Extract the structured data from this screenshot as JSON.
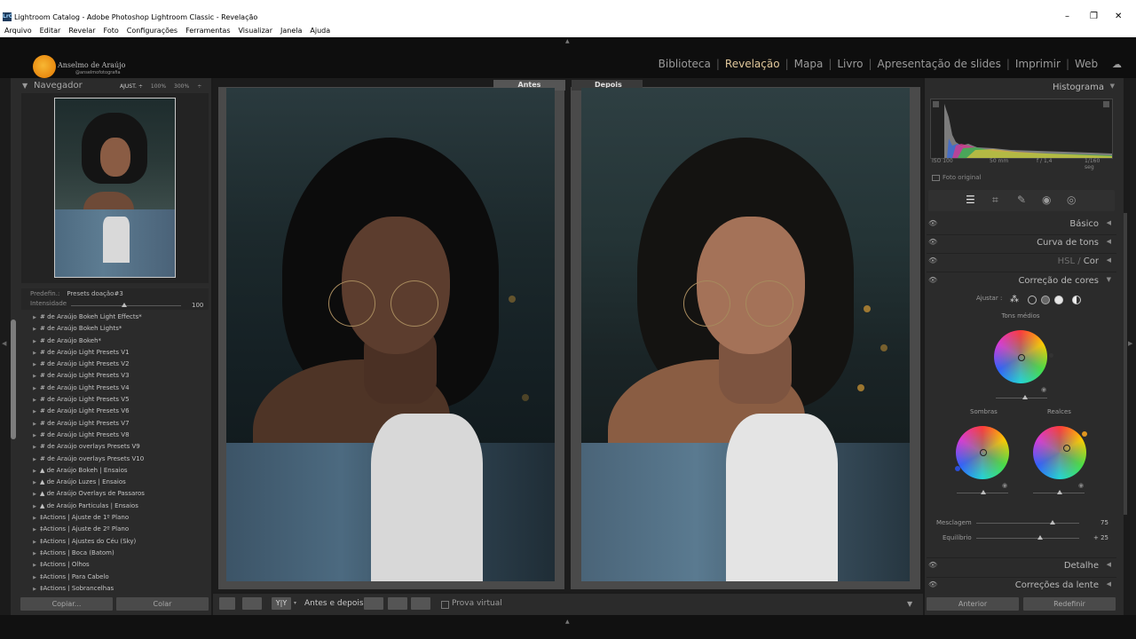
{
  "window": {
    "title": "Lightroom Catalog - Adobe Photoshop Lightroom Classic - Revelação",
    "app_icon_text": "LrC",
    "controls": [
      "–",
      "❐",
      "✕"
    ]
  },
  "menu": [
    "Arquivo",
    "Editar",
    "Revelar",
    "Foto",
    "Configurações",
    "Ferramentas",
    "Visualizar",
    "Janela",
    "Ajuda"
  ],
  "identity": {
    "name": "Anselmo de Araújo",
    "handle": "@anselmofotografia"
  },
  "modules": [
    {
      "label": "Biblioteca",
      "active": false
    },
    {
      "label": "Revelação",
      "active": true
    },
    {
      "label": "Mapa",
      "active": false
    },
    {
      "label": "Livro",
      "active": false
    },
    {
      "label": "Apresentação de slides",
      "active": false
    },
    {
      "label": "Imprimir",
      "active": false
    },
    {
      "label": "Web",
      "active": false
    }
  ],
  "navigator": {
    "title": "Navegador",
    "zoom_fit": "AJUST. ÷",
    "zoom_100": "100%",
    "zoom_300": "300%",
    "zoom_more": "÷"
  },
  "presets": {
    "predef_label": "Predefin.:",
    "predef_value": "Presets doação#3",
    "intensity_label": "Intensidade",
    "intensity_value": "100",
    "items": [
      "# de Araújo Bokeh Light Effects*",
      "# de Araújo Bokeh Lights*",
      "# de Araújo Bokeh*",
      "# de Araújo Light Presets V1",
      "# de Araújo Light Presets V2",
      "# de Araújo Light Presets V3",
      "# de Araújo Light Presets V4",
      "# de Araújo Light Presets V5",
      "# de Araújo Light Presets V6",
      "# de Araújo Light Presets V7",
      "# de Araújo Light Presets V8",
      "# de Araújo overlays Presets V9",
      "# de Araújo overlays Presets V10",
      "▲ de Araújo Bokeh | Ensaios",
      "▲ de Araújo Luzes | Ensaios",
      "▲ de Araújo Overlays de Passaros",
      "▲ de Araújo Particulas | Ensaios",
      "‡Actions | Ajuste de 1º Plano",
      "‡Actions | Ajuste de 2º Plano",
      "‡Actions | Ajustes do Céu (Sky)",
      "‡Actions | Boca (Batom)",
      "‡Actions | Olhos",
      "‡Actions | Para Cabelo",
      "‡Actions | Sobrancelhas"
    ]
  },
  "left_buttons": {
    "copy": "Copiar...",
    "paste": "Colar"
  },
  "compare": {
    "before": "Antes",
    "after": "Depois"
  },
  "toolbar": {
    "before_after_label": "Antes e depois:",
    "yy": "Y|Y",
    "soft_proof": "Prova virtual",
    "menu_arrow": "▼"
  },
  "histogram": {
    "title": "Histograma",
    "iso": "ISO 100",
    "focal": "50 mm",
    "aperture": "f / 1,4",
    "shutter": "1/160 seg",
    "original_photo": "Foto original"
  },
  "panels": {
    "basic": "Básico",
    "tone_curve": "Curva de tons",
    "hsl": "HSL",
    "hsl_sep": "/",
    "color": "Cor",
    "color_grading": "Correção de cores",
    "detail": "Detalhe",
    "lens": "Correções da lente"
  },
  "color_grading": {
    "adjust_label": "Ajustar :",
    "midtones": "Tons médios",
    "shadows": "Sombras",
    "highlights": "Realces",
    "blending_label": "Mesclagem",
    "blending_value": "75",
    "balance_label": "Equilíbrio",
    "balance_value": "+ 25"
  },
  "right_buttons": {
    "previous": "Anterior",
    "reset": "Redefinir"
  },
  "colors": {
    "accent_module": "#e0c79b",
    "panel_bg": "#2b2b2b",
    "logo_orange": "#f0a020"
  }
}
